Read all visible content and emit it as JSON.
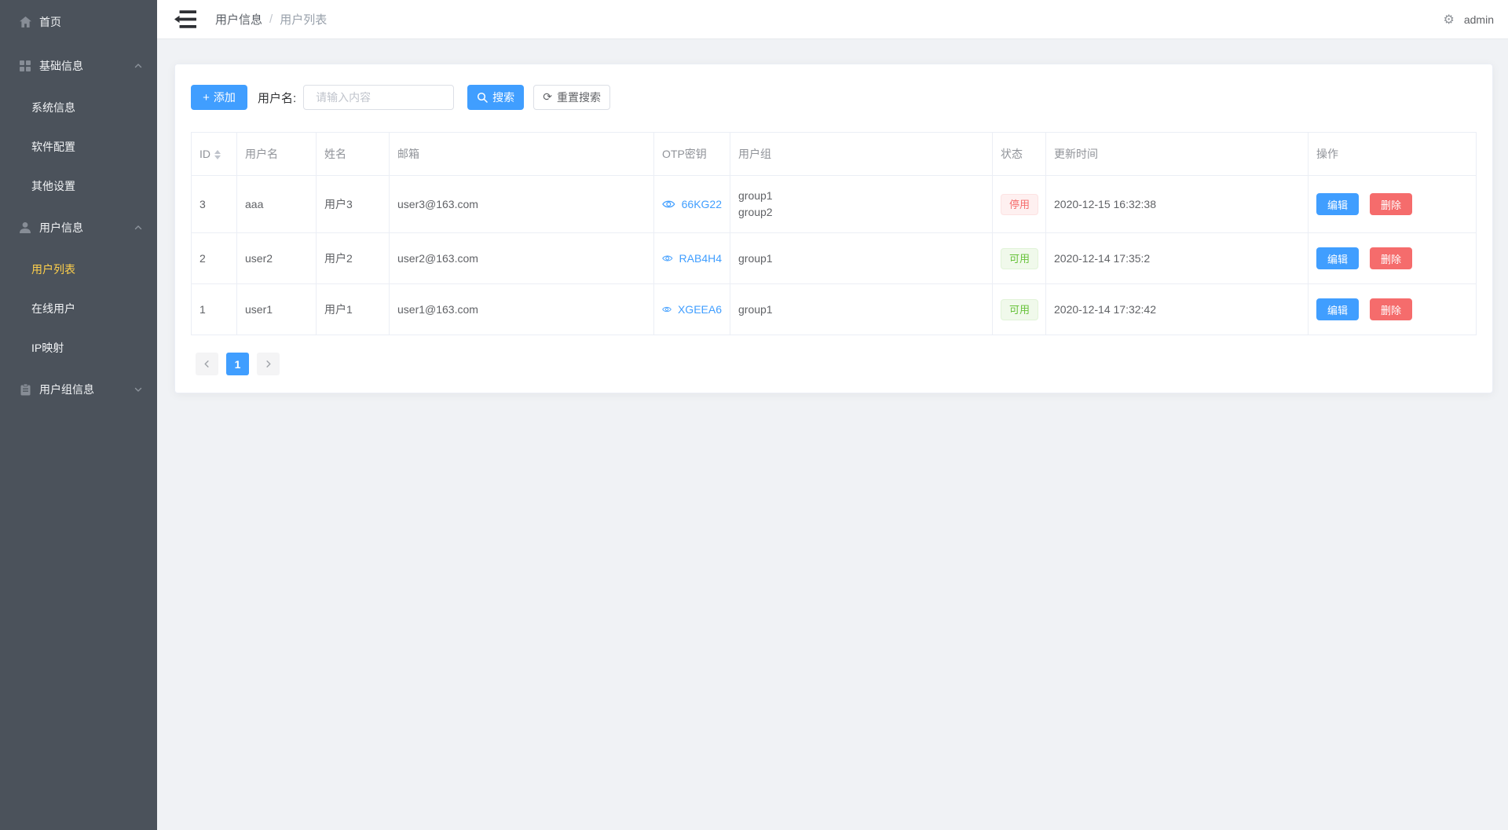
{
  "topbar": {
    "breadcrumb": [
      "用户信息",
      "用户列表"
    ],
    "separator": "/",
    "username": "admin"
  },
  "sidebar": {
    "items": [
      {
        "label": "首页",
        "icon": "home-icon",
        "type": "item",
        "children": []
      },
      {
        "label": "基础信息",
        "icon": "grid-icon",
        "type": "section",
        "expanded": true,
        "children": [
          {
            "label": "系统信息"
          },
          {
            "label": "软件配置"
          },
          {
            "label": "其他设置"
          }
        ]
      },
      {
        "label": "用户信息",
        "icon": "user-icon",
        "type": "section",
        "expanded": true,
        "children": [
          {
            "label": "用户列表",
            "active": true
          },
          {
            "label": "在线用户"
          },
          {
            "label": "IP映射"
          }
        ]
      },
      {
        "label": "用户组信息",
        "icon": "clipboard-icon",
        "type": "section",
        "expanded": false,
        "children": []
      }
    ]
  },
  "toolbar": {
    "add_label": "添加",
    "username_label": "用户名:",
    "search_placeholder": "请输入内容",
    "search_label": "搜索",
    "reset_label": "重置搜索"
  },
  "table": {
    "columns": [
      {
        "label": "ID",
        "sortable": true
      },
      {
        "label": "用户名"
      },
      {
        "label": "姓名"
      },
      {
        "label": "邮箱"
      },
      {
        "label": "OTP密钥"
      },
      {
        "label": "用户组"
      },
      {
        "label": "状态"
      },
      {
        "label": "更新时间"
      },
      {
        "label": "操作"
      }
    ],
    "edit_label": "编辑",
    "delete_label": "删除",
    "rows": [
      {
        "id": "3",
        "username": "aaa",
        "name": "用户3",
        "email": "user3@163.com",
        "otp": "66KG22",
        "groups": [
          "group1",
          "group2"
        ],
        "status": "停用",
        "status_type": "danger",
        "updated": "2020-12-15 16:32:38"
      },
      {
        "id": "2",
        "username": "user2",
        "name": "用户2",
        "email": "user2@163.com",
        "otp": "RAB4H4",
        "groups": [
          "group1"
        ],
        "status": "可用",
        "status_type": "success",
        "updated": "2020-12-14 17:35:2"
      },
      {
        "id": "1",
        "username": "user1",
        "name": "用户1",
        "email": "user1@163.com",
        "otp": "XGEEA6",
        "groups": [
          "group1"
        ],
        "status": "可用",
        "status_type": "success",
        "updated": "2020-12-14 17:32:42"
      }
    ]
  },
  "pagination": {
    "current": "1"
  },
  "colors": {
    "primary": "#409eff",
    "danger": "#f56c6c",
    "success": "#67c23a",
    "sidebar_bg": "#4b525b",
    "sidebar_active_text": "#ffd04b",
    "page_bg": "#f0f2f5"
  }
}
